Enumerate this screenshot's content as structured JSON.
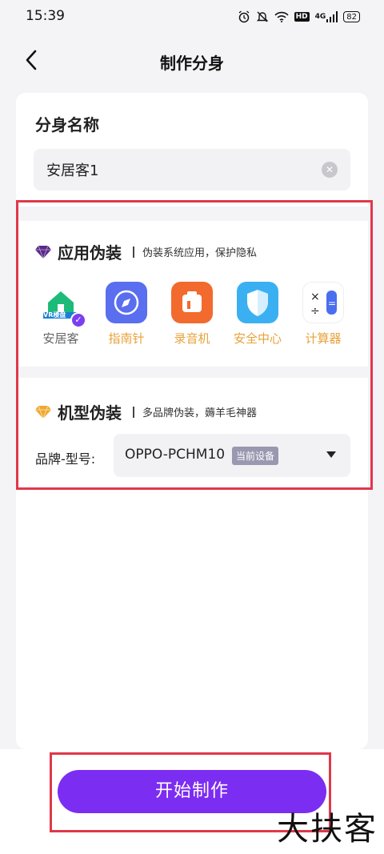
{
  "status_bar": {
    "time": "15:39",
    "network": "4G",
    "hd": "HD",
    "battery": "82"
  },
  "nav": {
    "title": "制作分身"
  },
  "clone_name": {
    "label": "分身名称",
    "value": "安居客1"
  },
  "app_disguise": {
    "title": "应用伪装",
    "desc": "伪装系统应用，保护隐私",
    "apps": [
      {
        "label": "安居客",
        "selected": true,
        "badge": "VR楼盘"
      },
      {
        "label": "指南针",
        "selected": false
      },
      {
        "label": "录音机",
        "selected": false
      },
      {
        "label": "安全中心",
        "selected": false
      },
      {
        "label": "计算器",
        "selected": false
      }
    ]
  },
  "model_disguise": {
    "title": "机型伪装",
    "desc": "多品牌伪装，薅羊毛神器",
    "label": "品牌-型号:",
    "value": "OPPO-PCHM10",
    "tag": "当前设备"
  },
  "start_button": {
    "label": "开始制作"
  },
  "watermark": "大扶客",
  "colors": {
    "accent": "#7c2df2",
    "highlight": "#e0384a",
    "app_label": "#e8a23a"
  }
}
